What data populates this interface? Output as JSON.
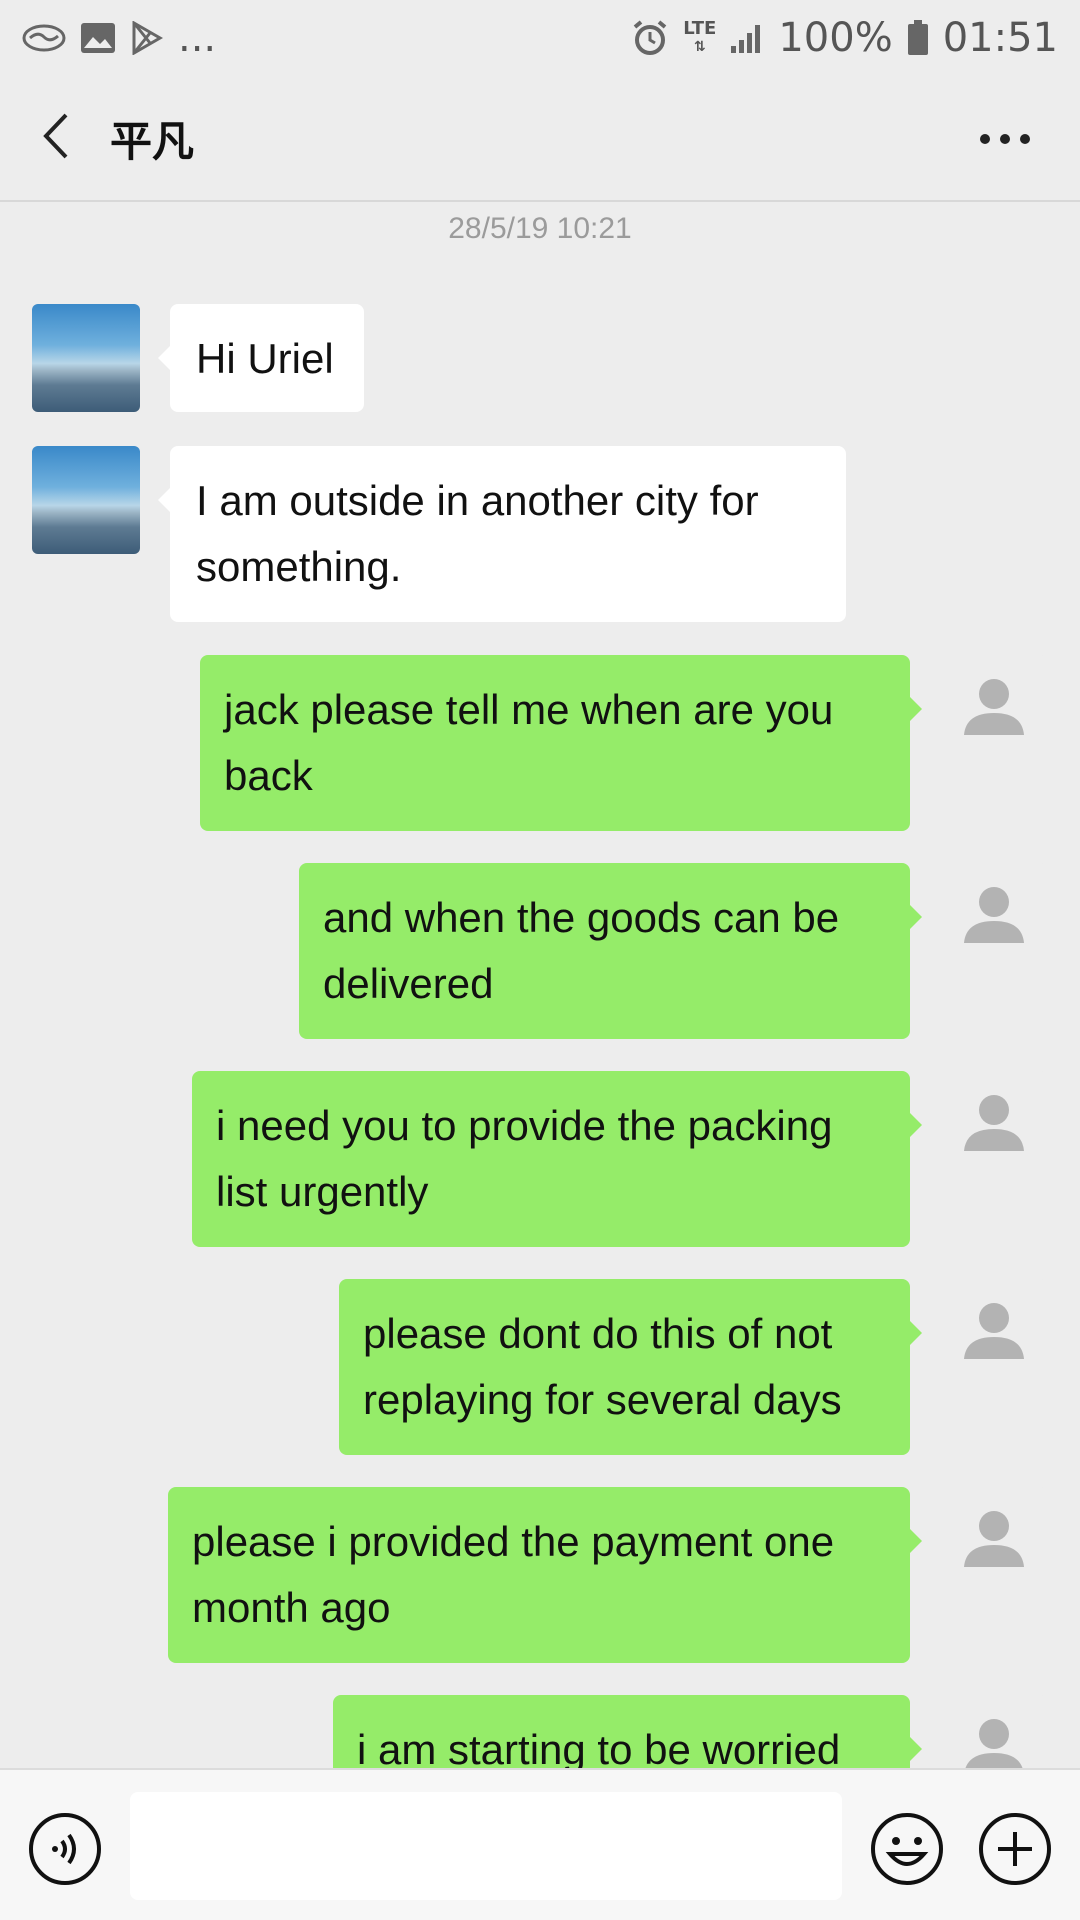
{
  "status_bar": {
    "left_icons": [
      "handshake-icon",
      "image-icon",
      "play-store-icon"
    ],
    "overflow": "...",
    "right_icons": [
      "alarm-icon",
      "lte-icon",
      "signal-icon",
      "battery-icon"
    ],
    "network_label": "LTE",
    "battery": "100%",
    "time": "01:51"
  },
  "header": {
    "title": "平凡",
    "back_icon": "chevron-left-icon",
    "more_icon": "more-dots-icon"
  },
  "chat": {
    "timestamp": "28/5/19 10:21",
    "messages": [
      {
        "direction": "incoming",
        "text": "Hi Uriel"
      },
      {
        "direction": "incoming",
        "text": "I am outside in another city for something."
      },
      {
        "direction": "outgoing",
        "text": "jack please tell me when are you back"
      },
      {
        "direction": "outgoing",
        "text": "and when the goods can be delivered"
      },
      {
        "direction": "outgoing",
        "text": "i need you to provide the packing list urgently"
      },
      {
        "direction": "outgoing",
        "text": "please dont do this of not replaying for several days"
      },
      {
        "direction": "outgoing",
        "text": "please i provided the payment  one month ago"
      },
      {
        "direction": "outgoing",
        "text": "i am starting to be worried"
      }
    ]
  },
  "input_bar": {
    "voice_icon": "voice-icon",
    "text_value": "",
    "emoji_icon": "emoji-icon",
    "plus_icon": "plus-icon"
  },
  "colors": {
    "background": "#ededed",
    "outgoing_bubble": "#95ec69",
    "incoming_bubble": "#ffffff",
    "placeholder_avatar": "#b3b3b3"
  }
}
